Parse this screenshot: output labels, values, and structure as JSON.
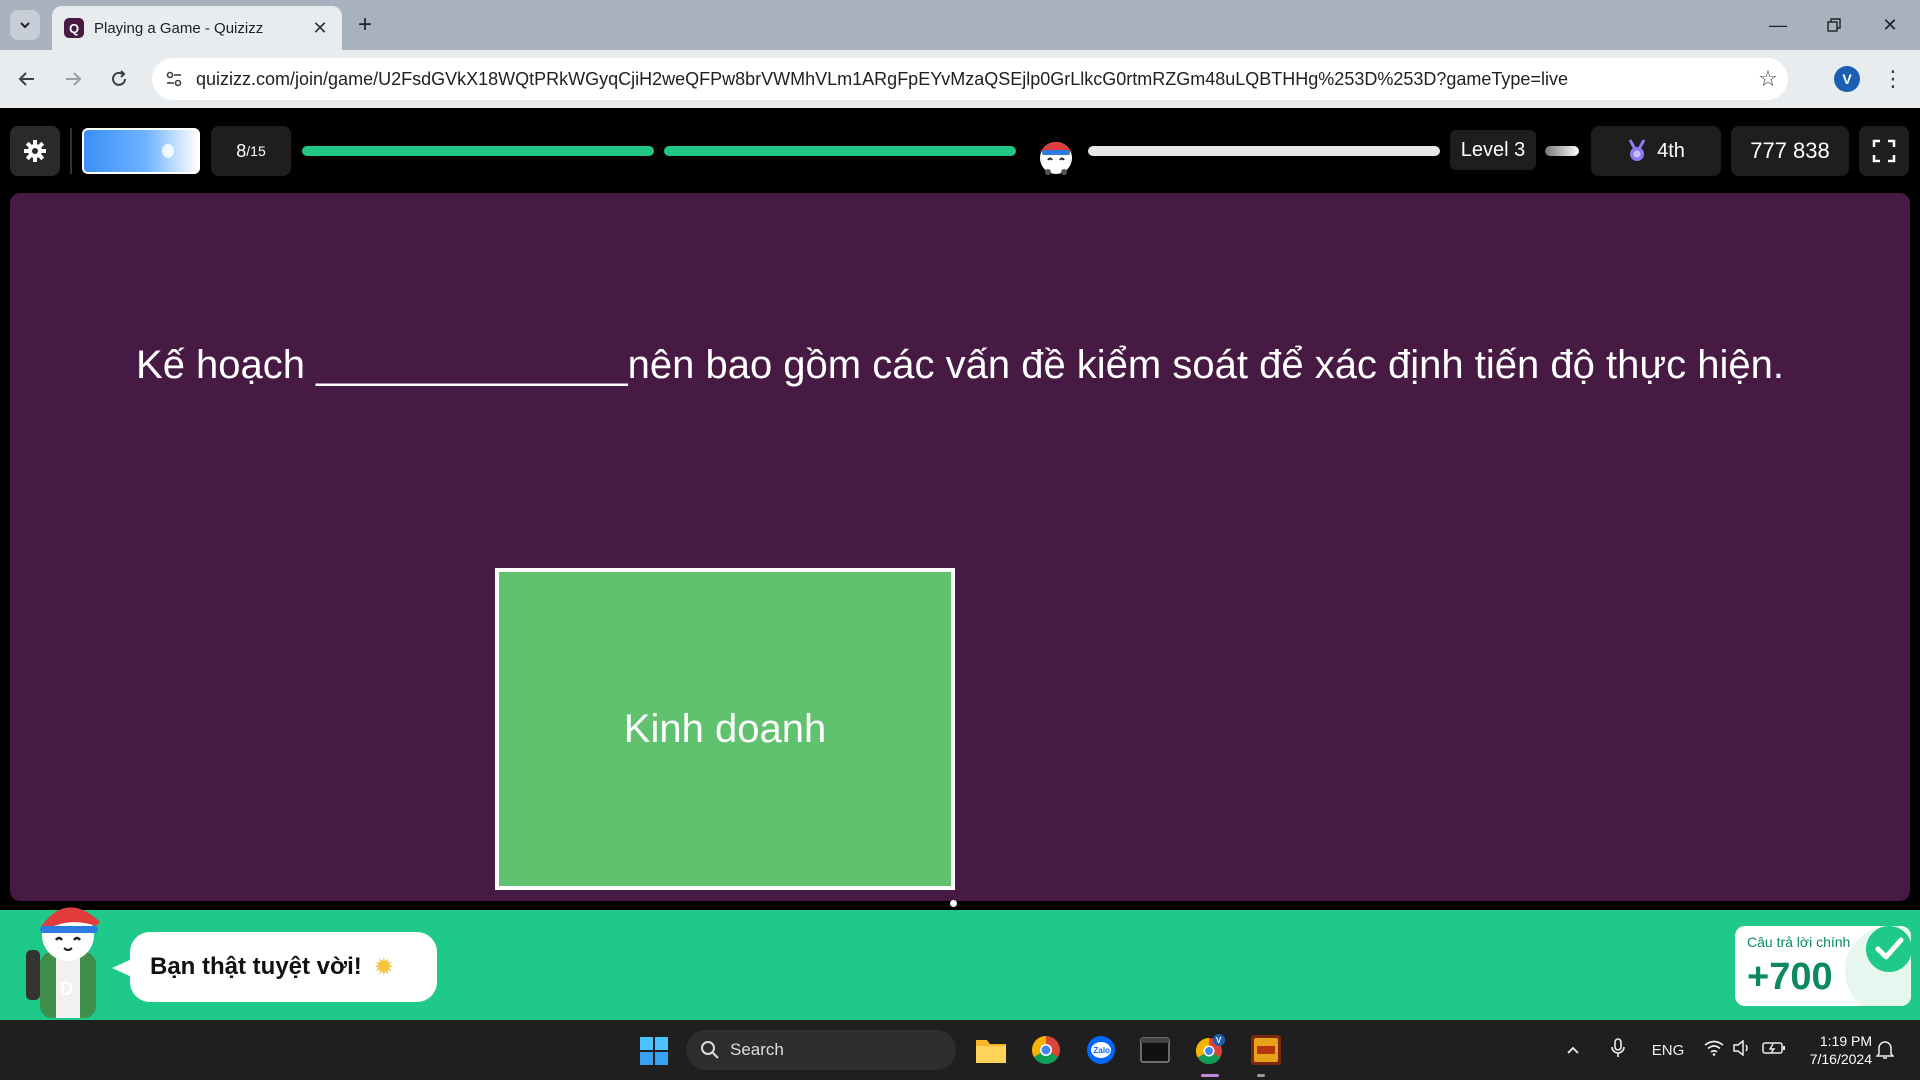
{
  "browser": {
    "tab_title": "Playing a Game - Quizizz",
    "tab_favicon": "Q",
    "url": "quizizz.com/join/game/U2FsdGVkX18WQtPRkWGyqCjiH2weQFPw8brVWMhVLm1ARgFpEYvMzaQSEjlp0GrLlkcG0rtmRZGm48uLQBTHHg%253D%253D?gameType=live",
    "profile_initial": "V"
  },
  "game": {
    "question_current": "8",
    "question_total": "/15",
    "progress_segments": [
      {
        "state": "filled"
      },
      {
        "state": "filled"
      },
      {
        "state": "empty"
      }
    ],
    "level": "Level 3",
    "rank": "4th",
    "score": "777 838",
    "question": "Kế hoạch ______________nên bao gồm các vấn đề kiểm soát để xác định tiến độ thực hiện.",
    "answer": "Kinh doanh",
    "colors": {
      "panel": "#461a42",
      "answer": "#60c26f",
      "progress": "#22c786",
      "feedback": "#1ec98a"
    }
  },
  "feedback": {
    "message": "Bạn thật tuyệt vời!",
    "card_label": "Câu trả lời chính",
    "points": "+700"
  },
  "taskbar": {
    "search_label": "Search",
    "language": "ENG",
    "time": "1:19 PM",
    "date": "7/16/2024",
    "apps": [
      "file-explorer-icon",
      "chrome-icon",
      "zalo-icon",
      "terminal-icon",
      "chrome-profile-icon",
      "game-icon"
    ]
  }
}
